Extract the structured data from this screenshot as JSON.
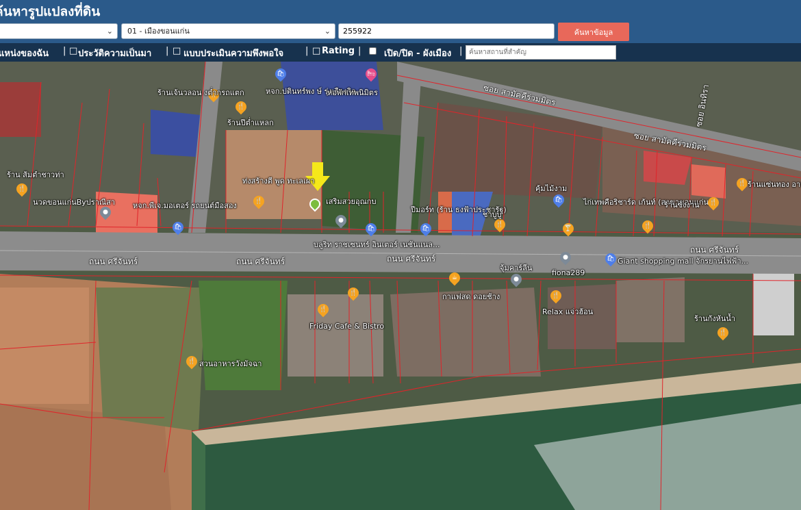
{
  "header": {
    "title": "ค้นหารูปแปลงที่ดิน"
  },
  "search": {
    "province_value": "",
    "district_value": "01 - เมืองขอนแก่น",
    "parcel_value": "255922",
    "search_button": "ค้นหาข้อมูล"
  },
  "menu": {
    "my_location": "แหน่งของฉัน",
    "history": "ประวัติความเป็นมา",
    "survey": "แบบประเมินความพึงพอใจ",
    "rating": "Rating",
    "toggle_label": "เปิด/ปิด - ผังเมือง",
    "place_placeholder": "ค้นหาสถานที่สำคัญ",
    "sep": "|",
    "box": "□"
  },
  "map": {
    "roads": [
      {
        "text": "ซอย สามัคคีร่วมมิตร"
      },
      {
        "text": "ซอย สามัคคีร่วมมิตร"
      },
      {
        "text": "ถนน ศรีจันทร์"
      },
      {
        "text": "ถนน ศรีจันทร์"
      },
      {
        "text": "ถนน ศรีจันทร์"
      },
      {
        "text": "ถนน ศรีจันทร์"
      },
      {
        "text": "ซอย อินทิรา"
      }
    ],
    "places": [
      {
        "text": "ร้านเจ้นวลอน งต่ำกรถแตก",
        "icon": "restaurant-icon"
      },
      {
        "text": "ร้านปีต่ำแหลก",
        "icon": "restaurant-icon"
      },
      {
        "text": "หจก.ปตินทร์พง ษ์ รุ่งเรืองกิจ",
        "icon": "shop-icon"
      },
      {
        "text": "หอพักเทพนิมิตร",
        "icon": "hotel-icon"
      },
      {
        "text": "ร้าน ส้มตำชาวท่า",
        "icon": "restaurant-icon"
      },
      {
        "text": "นวดขอนแก่นByปราณีสา",
        "icon": "pin-icon"
      },
      {
        "text": "หจก.พีเจ.มอเตอร์ รถยนต์มือสอง",
        "icon": "shop-icon"
      },
      {
        "text": "ท่งสร้างตี พูด ทะเลเผา",
        "icon": "restaurant-icon"
      },
      {
        "text": "เสริมสวยอุณกบ",
        "icon": "pin-icon"
      },
      {
        "text": "บลูริท ราชเซนทร์ อินเตอร์ เนชันแนล...",
        "icon": "shop-icon"
      },
      {
        "text": "ปีมอร์ท (ร้าน ธงฟ้าประชารัฐ)",
        "icon": "shop-icon"
      },
      {
        "text": "ชาบูบู",
        "icon": "restaurant-icon"
      },
      {
        "text": "คุ้มไม้งาม",
        "icon": "shop-icon"
      },
      {
        "text": "ไก่เทพคือริชาร์ด เก้นท์ (สาขาขอนแก่น)",
        "icon": "bar-icon"
      },
      {
        "text": "ร้านซ้งงาน",
        "icon": "restaurant-icon"
      },
      {
        "text": "ร้านแซ่นทอง อาหารตามสั่ง",
        "icon": "restaurant-icon"
      },
      {
        "text": "จุ้มคาร์ลีน",
        "icon": "pin-icon"
      },
      {
        "text": "fiona289",
        "icon": "pin-icon"
      },
      {
        "text": "Giant shopping mall จักรยานไฟฟ้า...",
        "icon": "shop-icon"
      },
      {
        "text": "กาแฟสด ดอยช้าง",
        "icon": "cafe-icon"
      },
      {
        "text": "Friday Cafe & Bistro",
        "icon": "restaurant-icon"
      },
      {
        "text": "Relax แจ่วฮ้อน",
        "icon": "restaurant-icon"
      },
      {
        "text": "ร้านกังหันน้ำ",
        "icon": "restaurant-icon"
      },
      {
        "text": "สวนอาหารวังมัจฉา",
        "icon": "restaurant-icon"
      }
    ],
    "marker_color": "#f5e81a"
  }
}
